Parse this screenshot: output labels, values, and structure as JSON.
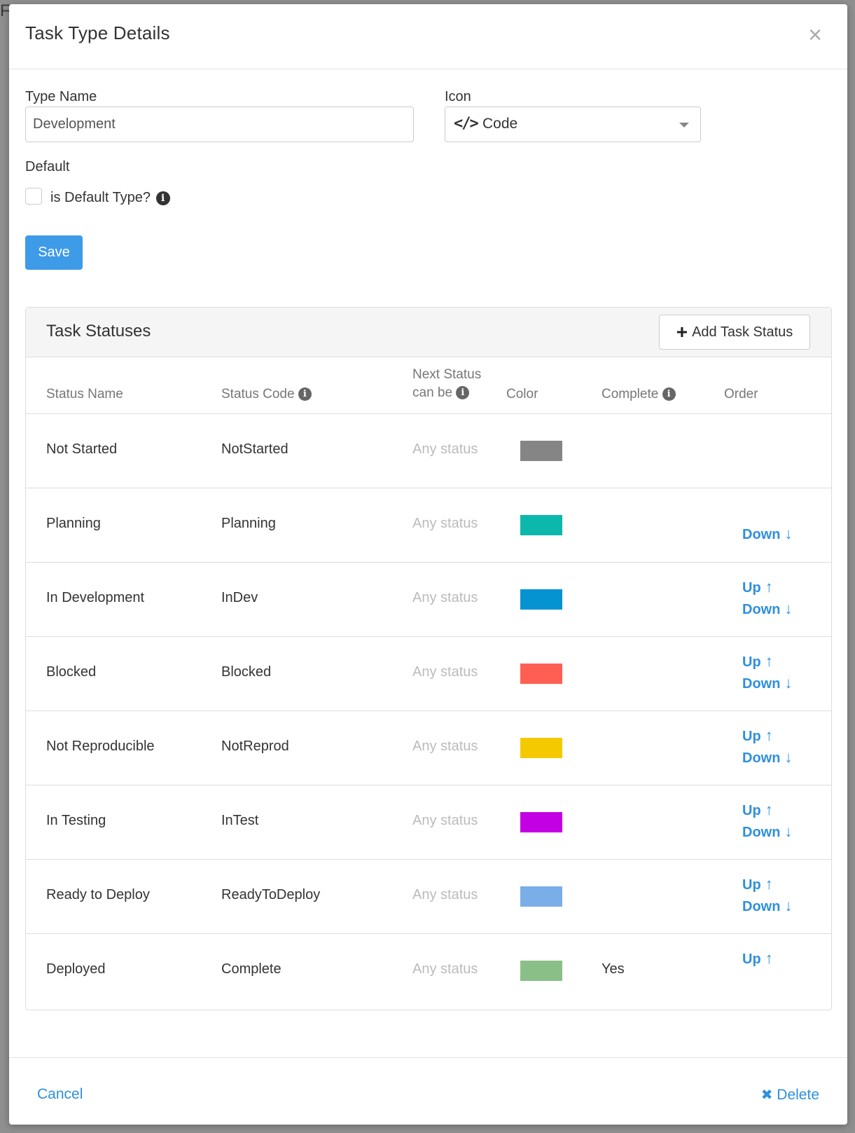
{
  "modal": {
    "title": "Task Type Details",
    "close_symbol": "×"
  },
  "form": {
    "type_name_label": "Type Name",
    "type_name_value": "Development",
    "icon_label": "Icon",
    "icon_value": "Code",
    "icon_glyph": "</>",
    "default_label": "Default",
    "default_checkbox_label": "is Default Type?",
    "default_checked": false,
    "save_label": "Save"
  },
  "statuses_panel": {
    "title": "Task Statuses",
    "add_label": "Add Task Status",
    "columns": {
      "status_name": "Status Name",
      "status_code": "Status Code",
      "next_status_line1": "Next Status",
      "next_status_line2": "can be",
      "color": "Color",
      "complete": "Complete",
      "order": "Order"
    },
    "rows": [
      {
        "name": "Not Started",
        "code": "NotStarted",
        "next": "Any status",
        "color": "#858585",
        "complete": "",
        "up": "",
        "down": ""
      },
      {
        "name": "Planning",
        "code": "Planning",
        "next": "Any status",
        "color": "#0bb8ab",
        "complete": "",
        "up": "",
        "down": "Down"
      },
      {
        "name": "In Development",
        "code": "InDev",
        "next": "Any status",
        "color": "#0593d2",
        "complete": "",
        "up": "Up",
        "down": "Down"
      },
      {
        "name": "Blocked",
        "code": "Blocked",
        "next": "Any status",
        "color": "#ff5f52",
        "complete": "",
        "up": "Up",
        "down": "Down"
      },
      {
        "name": "Not Reproducible",
        "code": "NotReprod",
        "next": "Any status",
        "color": "#f5c900",
        "complete": "",
        "up": "Up",
        "down": "Down"
      },
      {
        "name": "In Testing",
        "code": "InTest",
        "next": "Any status",
        "color": "#c200e3",
        "complete": "",
        "up": "Up",
        "down": "Down"
      },
      {
        "name": "Ready to Deploy",
        "code": "ReadyToDeploy",
        "next": "Any status",
        "color": "#7aaee9",
        "complete": "",
        "up": "Up",
        "down": "Down"
      },
      {
        "name": "Deployed",
        "code": "Complete",
        "next": "Any status",
        "color": "#8ac087",
        "complete": "Yes",
        "up": "Up",
        "down": ""
      }
    ]
  },
  "footer": {
    "cancel_label": "Cancel",
    "delete_label": "Delete",
    "delete_symbol": "✖"
  },
  "colors": {
    "accent": "#2e90dd",
    "save_button": "#3e9be8"
  }
}
